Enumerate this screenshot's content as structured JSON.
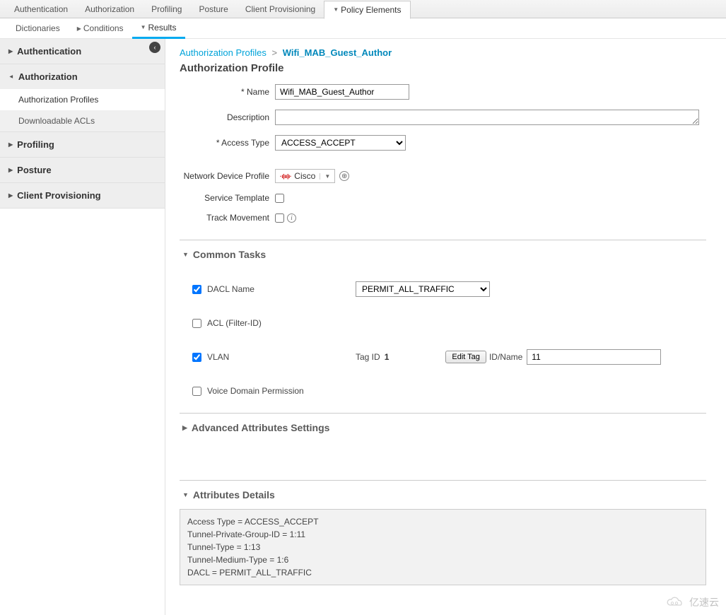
{
  "top_tabs": {
    "authentication": "Authentication",
    "authorization": "Authorization",
    "profiling": "Profiling",
    "posture": "Posture",
    "client_provisioning": "Client Provisioning",
    "policy_elements": "Policy Elements"
  },
  "sub_tabs": {
    "dictionaries": "Dictionaries",
    "conditions": "Conditions",
    "results": "Results"
  },
  "sidebar": {
    "authentication": "Authentication",
    "authorization": "Authorization",
    "authorization_profiles": "Authorization Profiles",
    "downloadable_acls": "Downloadable ACLs",
    "profiling": "Profiling",
    "posture": "Posture",
    "client_provisioning": "Client Provisioning"
  },
  "breadcrumb": {
    "parent": "Authorization Profiles",
    "current": "Wifi_MAB_Guest_Author"
  },
  "page_title": "Authorization Profile",
  "form": {
    "name_label": "* Name",
    "name_value": "Wifi_MAB_Guest_Author",
    "description_label": "Description",
    "description_value": "",
    "access_type_label": "* Access Type",
    "access_type_value": "ACCESS_ACCEPT",
    "ndp_label": "Network Device Profile",
    "ndp_value": "Cisco",
    "service_template_label": "Service Template",
    "track_movement_label": "Track Movement"
  },
  "sections": {
    "common_tasks": "Common Tasks",
    "advanced_attributes": "Advanced Attributes Settings",
    "attributes_details": "Attributes Details"
  },
  "tasks": {
    "dacl_label": "DACL Name",
    "dacl_value": "PERMIT_ALL_TRAFFIC",
    "acl_label": "ACL  (Filter-ID)",
    "vlan_label": "VLAN",
    "vlan_tag_id_label": "Tag ID",
    "vlan_tag_id_value": "1",
    "vlan_edit_tag": "Edit Tag",
    "vlan_idname_label": "ID/Name",
    "vlan_idname_value": "11",
    "voice_label": "Voice Domain Permission"
  },
  "details": {
    "line1": "Access Type = ACCESS_ACCEPT",
    "line2": "Tunnel-Private-Group-ID = 1:11",
    "line3": "Tunnel-Type = 1:13",
    "line4": "Tunnel-Medium-Type = 1:6",
    "line5": "DACL = PERMIT_ALL_TRAFFIC"
  },
  "watermark": "亿速云"
}
